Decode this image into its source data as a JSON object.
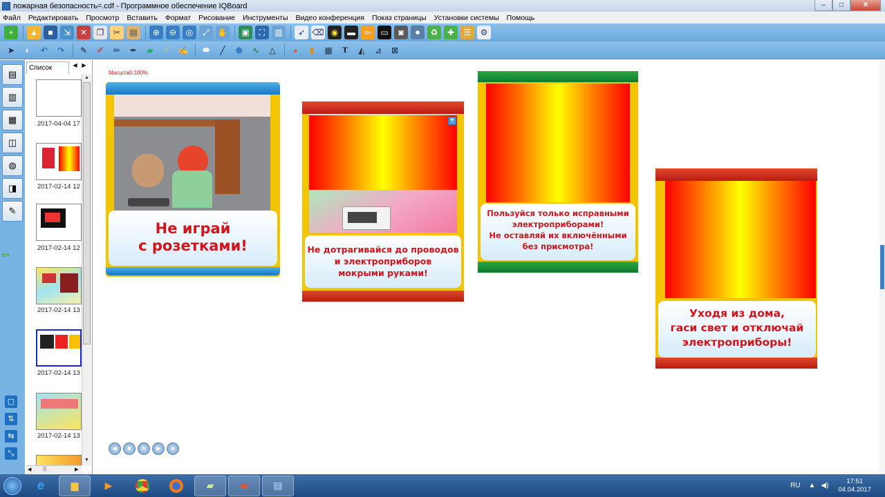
{
  "window": {
    "title": "пожарная безопасность=.cdf - Программное обеспечение IQBoard",
    "minimize": "–",
    "maximize": "□",
    "close": "✕"
  },
  "menu": [
    "Файл",
    "Редактировать",
    "Просмотр",
    "Вставить",
    "Формат",
    "Рисование",
    "Инструменты",
    "Видео конференция",
    "Показ страницы",
    "Установки системы",
    "Помощь"
  ],
  "toolbar1_icons": [
    "new-page-icon",
    "open-icon",
    "save-icon",
    "export-icon",
    "delete-icon",
    "copy-icon",
    "cut-icon",
    "paste-icon",
    "zoom-in-icon",
    "zoom-out-icon",
    "zoom-icon",
    "fit-icon",
    "pan-icon",
    "screenshot-icon",
    "fullscreen-icon",
    "dual-screen-icon",
    "pointer-icon",
    "eraser-icon",
    "spotlight-icon",
    "screen-shade-icon",
    "back-icon",
    "display-icon",
    "camera-icon",
    "record-icon",
    "recycle-icon",
    "add-icon",
    "clear-icon",
    "settings-icon"
  ],
  "toolbar2_icons": [
    "select-icon",
    "mouse-icon",
    "undo-icon",
    "redo-icon",
    "pen-icon",
    "brush-icon",
    "pencil-icon",
    "marker-icon",
    "highlighter-icon",
    "laser-pen-icon",
    "smart-pen-icon",
    "eraser-tool-icon",
    "line-icon",
    "polygon-icon",
    "chart-icon",
    "shape-icon",
    "color-icon",
    "gallery-icon",
    "table-icon",
    "text-icon",
    "fill-icon",
    "ruler-icon",
    "protractor-icon"
  ],
  "left_tools": [
    "page-icon",
    "library-icon",
    "resource-icon",
    "toolbox-icon",
    "web-icon",
    "chart-tool-icon",
    "notes-icon"
  ],
  "left_bottom": [
    "screen-icon",
    "sort-icon",
    "swap-icon",
    "expand-icon"
  ],
  "sidepanel": {
    "tab": "Список",
    "thumbnails": [
      {
        "label": "2017-04-04 17"
      },
      {
        "label": "2017-02-14 12"
      },
      {
        "label": "2017-02-14 12"
      },
      {
        "label": "2017-02-14 13"
      },
      {
        "label": "2017-02-14 13",
        "selected": true
      },
      {
        "label": "2017-02-14 13"
      },
      {
        "label": ""
      }
    ]
  },
  "canvas": {
    "zoom": "Масштаб:100%",
    "cards": [
      {
        "text": "Не играй\nс розетками!"
      },
      {
        "text": "Не дотрагивайся до проводов\nи электроприборов\nмокрыми руками!"
      },
      {
        "text": "Пользуйся только исправными\nэлектроприборами!\nНе оставляй их включёнными\nбез присмотра!"
      },
      {
        "text": "Уходя из дома,\nгаси свет и отключай\nэлектроприборы!"
      }
    ]
  },
  "nav_buttons": [
    "◀",
    "■",
    "↻",
    "▶",
    "●"
  ],
  "tray": {
    "lang": "RU",
    "time": "17:51",
    "date": "04.04.2017"
  },
  "colors": {
    "toolbar": "#7ab6e6",
    "accent_red": "#d2141d",
    "taskbar": "#2a5a95"
  }
}
